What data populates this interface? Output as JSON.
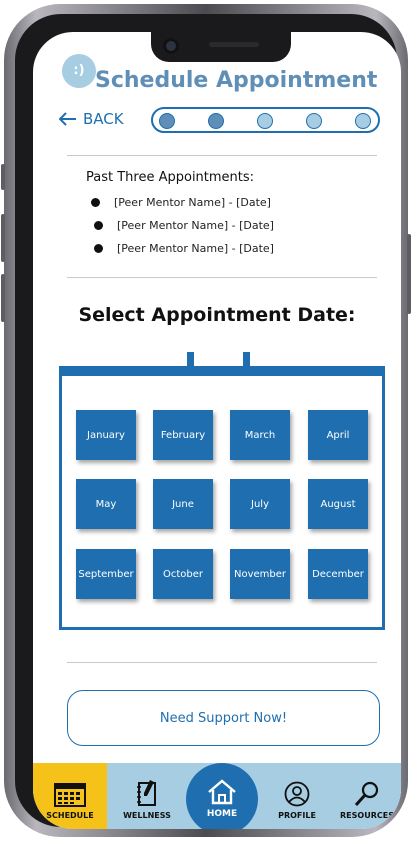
{
  "header": {
    "title": "Schedule Appointment",
    "logo_text": ":)"
  },
  "nav": {
    "back_label": "BACK"
  },
  "progress": {
    "total_steps": 5,
    "completed_steps": 2
  },
  "past": {
    "title": "Past Three Appointments:",
    "items": [
      "[Peer Mentor Name] - [Date]",
      "[Peer Mentor Name] - [Date]",
      "[Peer Mentor Name] - [Date]"
    ]
  },
  "select": {
    "title": "Select Appointment Date:"
  },
  "months": [
    "January",
    "February",
    "March",
    "April",
    "May",
    "June",
    "July",
    "August",
    "September",
    "October",
    "November",
    "December"
  ],
  "support": {
    "label": "Need Support Now!"
  },
  "tabs": {
    "schedule": "SCHEDULE",
    "wellness": "WELLNESS",
    "home": "HOME",
    "profile": "PROFILE",
    "resources": "RESOURCES"
  },
  "colors": {
    "accent": "#1f6fb0",
    "light": "#a6cde1",
    "title": "#5f8eb6",
    "active_tab": "#f5c21a"
  }
}
